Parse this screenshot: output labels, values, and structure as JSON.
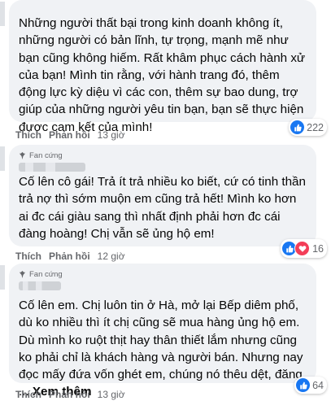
{
  "comments": [
    {
      "badge": "",
      "text": "Những người thất bại trong kinh doanh không ít, những người có bản lĩnh, tự trọng, mạnh mẽ như bạn cũng không hiếm. Rất khâm phục cách hành xử của bạn! Mình tin rằng, với hành trang đó, thêm động lực kỳ diệu vì các con, thêm sự bao dung, trợ giúp của những người yêu tin bạn, bạn sẽ thực hiện được cam kết của mình!",
      "like": "Thích",
      "reply": "Phản hồi",
      "time": "13 giờ",
      "reaction_count": "222",
      "reaction_icons": [
        "like-icon"
      ]
    },
    {
      "badge": "Fan cứng",
      "text": "Cố lên cô gái! Trả ít trả nhiều ko biết, cứ có tinh thần trả nợ thì sớm muộn em cũng trả hết! Mình ko hơn ai đc cái giàu sang thì nhất định phải hơn đc cái đàng hoàng! Chị vẫn sẽ ủng hộ em!",
      "like": "Thích",
      "reply": "Phản hồi",
      "time": "12 giờ",
      "reaction_count": "16",
      "reaction_icons": [
        "like-icon",
        "love-icon"
      ]
    },
    {
      "badge": "Fan cứng",
      "text": "Cố lên em. Chị luôn tin ở Hà, mở lại Bếp diêm phố, dù ko nhiều thì ít chị cũng sẽ mua hàng ủng hộ em. Dù mình ko ruột thịt hay thân thiết lắm nhưng cũng ko phải chỉ là khách hàng và người bán. Nhưng nay đọc mấy đứa vốn ghét em, chúng nó thêu dệt, đăng ...",
      "see_more": "Xem thêm",
      "like": "Thích",
      "reply": "Phản hồi",
      "time": "13 giờ",
      "reaction_count": "64",
      "reaction_icons": [
        "like-icon"
      ]
    }
  ]
}
